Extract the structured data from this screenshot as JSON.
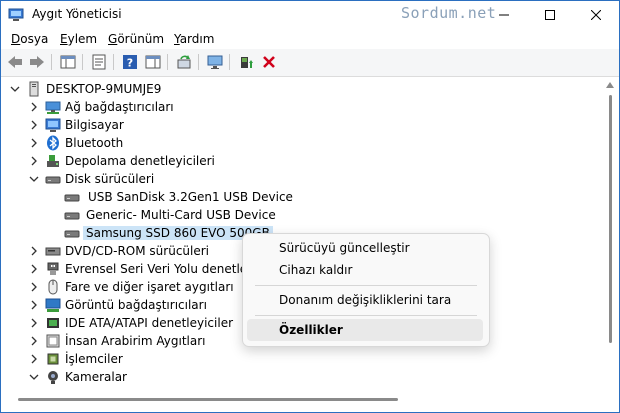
{
  "window": {
    "title": "Aygıt Yöneticisi",
    "watermark": "Sordum.net"
  },
  "menubar": [
    {
      "label": "Dosya",
      "accel": "D",
      "rest": "osya"
    },
    {
      "label": "Eylem",
      "accel": "E",
      "rest": "ylem"
    },
    {
      "label": "Görünüm",
      "accel": "G",
      "rest": "örünüm"
    },
    {
      "label": "Yardım",
      "accel": "Y",
      "rest": "ardım"
    }
  ],
  "tree": {
    "root": "DESKTOP-9MUMJE9",
    "items": [
      {
        "label": "Ağ bağdaştırıcıları",
        "icon": "network-adapter-icon"
      },
      {
        "label": "Bilgisayar",
        "icon": "computer-icon"
      },
      {
        "label": "Bluetooth",
        "icon": "bluetooth-icon"
      },
      {
        "label": "Depolama denetleyicileri",
        "icon": "storage-controller-icon"
      },
      {
        "label": "Disk sürücüleri",
        "icon": "disk-drive-icon",
        "expanded": true
      },
      {
        "label": "USB  SanDisk 3.2Gen1 USB Device",
        "icon": "disk-drive-icon",
        "child": true
      },
      {
        "label": "Generic- Multi-Card USB Device",
        "icon": "disk-drive-icon",
        "child": true
      },
      {
        "label": "Samsung SSD 860 EVO 500GB",
        "icon": "disk-drive-icon",
        "child": true,
        "selected": true
      },
      {
        "label": "DVD/CD-ROM sürücüleri",
        "icon": "dvd-drive-icon"
      },
      {
        "label": "Evrensel Seri Veri Yolu denetleyicileri",
        "icon": "usb-controller-icon"
      },
      {
        "label": "Fare ve diğer işaret aygıtları",
        "icon": "mouse-icon"
      },
      {
        "label": "Görüntü bağdaştırıcıları",
        "icon": "display-adapter-icon"
      },
      {
        "label": "IDE ATA/ATAPI denetleyiciler",
        "icon": "ide-controller-icon"
      },
      {
        "label": "İnsan Arabirim Aygıtları",
        "icon": "hid-icon"
      },
      {
        "label": "İşlemciler",
        "icon": "processor-icon"
      },
      {
        "label": "Kameralar",
        "icon": "camera-icon"
      }
    ]
  },
  "context_menu": {
    "update_driver": "Sürücüyü güncelleştir",
    "uninstall_device": "Cihazı kaldır",
    "scan_hardware": "Donanım değişikliklerini tara",
    "properties": "Özellikler"
  },
  "colors": {
    "selection": "#cce4f7",
    "window_border": "#2b6fc0",
    "uninstall_red": "#d0021b"
  }
}
